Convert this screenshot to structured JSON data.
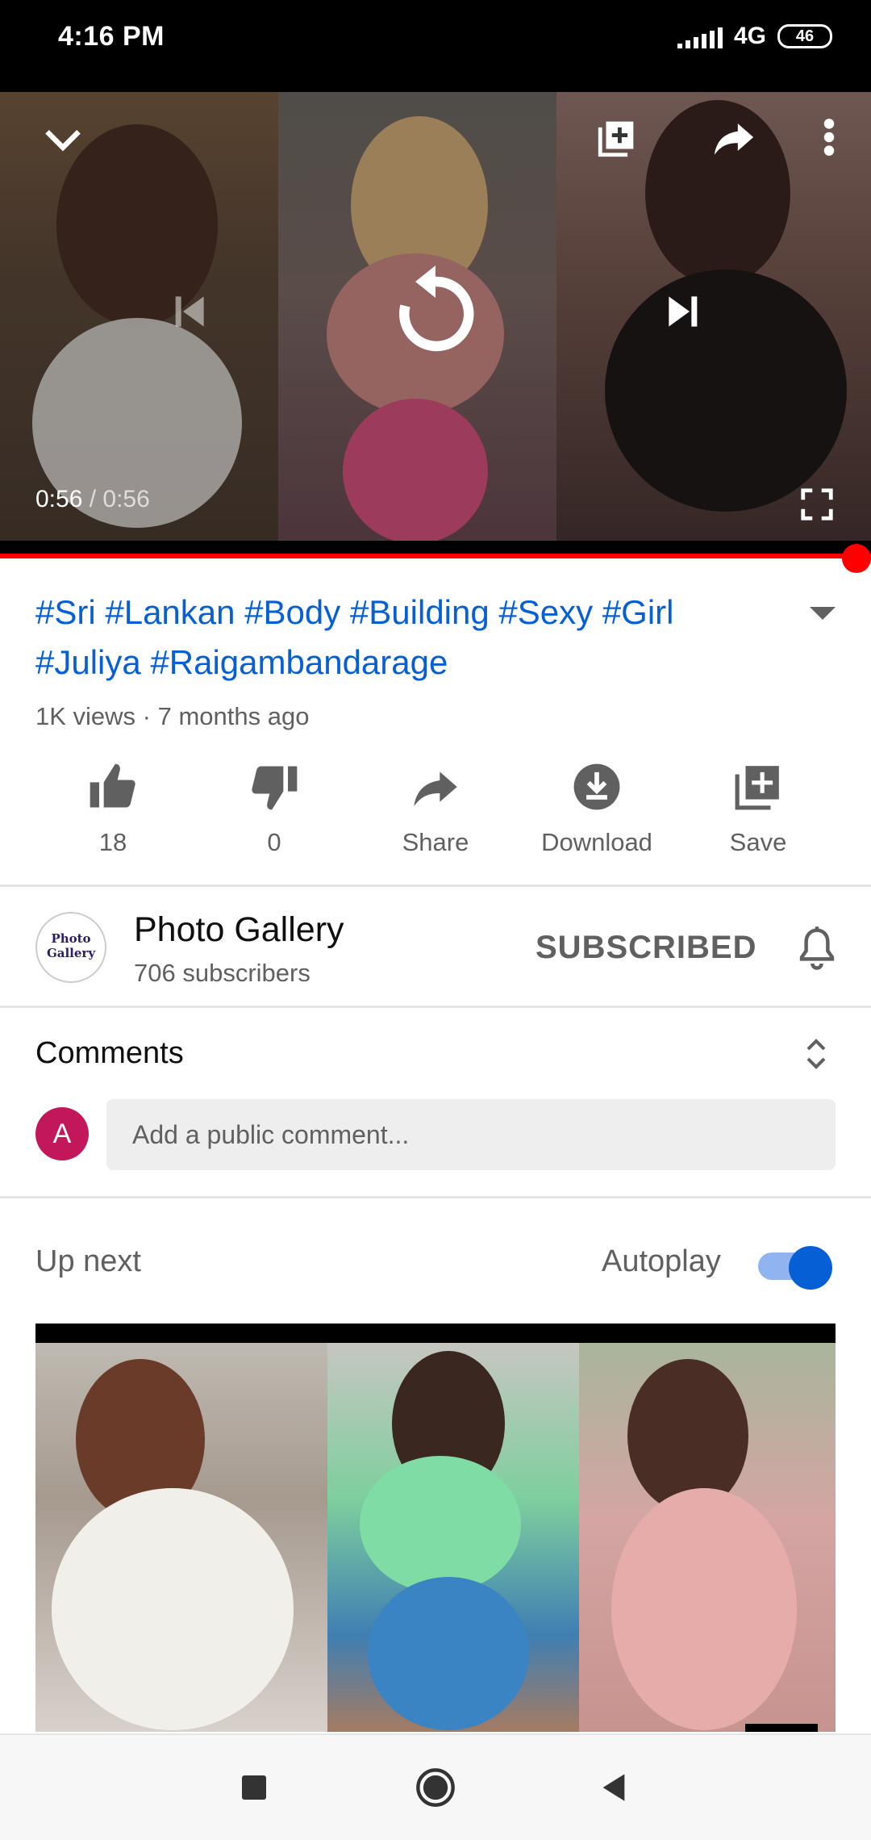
{
  "status_bar": {
    "time": "4:16 PM",
    "network": "4G",
    "battery": "46"
  },
  "player": {
    "current_time": "0:56",
    "duration": "0:56",
    "progress": 1.0
  },
  "video": {
    "title": "#Sri #Lankan #Body #Building #Sexy #Girl #Juliya #Raigambandarage",
    "meta": "1K views · 7 months ago"
  },
  "actions": {
    "like_count": "18",
    "dislike_count": "0",
    "share_label": "Share",
    "download_label": "Download",
    "save_label": "Save"
  },
  "channel": {
    "name": "Photo Gallery",
    "subscribers": "706 subscribers",
    "logo_text": "Photo Gallery",
    "subscribe_state": "SUBSCRIBED"
  },
  "comments": {
    "title": "Comments",
    "user_initial": "A",
    "placeholder": "Add a public comment..."
  },
  "up_next": {
    "title": "Up next",
    "autoplay_label": "Autoplay",
    "autoplay_on": true
  },
  "colors": {
    "link": "#065fd4",
    "progress": "#ff0000",
    "avatar": "#c2185b"
  },
  "icons": [
    "chevron-down-icon",
    "add-to-playlist-icon",
    "share-icon",
    "more-vert-icon",
    "previous-icon",
    "replay-icon",
    "next-icon",
    "fullscreen-icon",
    "thumbs-up-icon",
    "thumbs-down-icon",
    "download-icon",
    "bell-icon",
    "expand-icon",
    "stop-icon",
    "home-icon",
    "back-icon"
  ]
}
